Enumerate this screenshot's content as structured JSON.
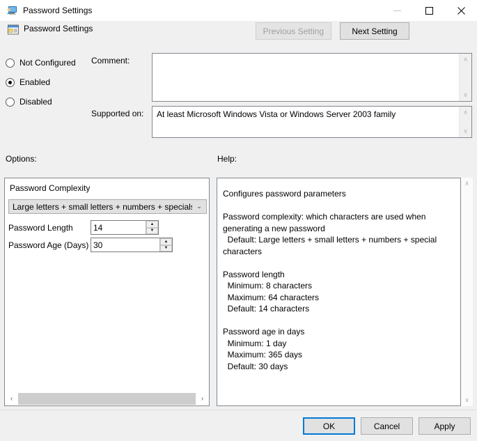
{
  "window": {
    "title": "Password Settings",
    "icon": "computer-user-icon",
    "minimize_label": "–",
    "maximize_label": "☐",
    "close_label": "✕"
  },
  "header": {
    "icon": "policy-setting-icon",
    "title": "Password Settings",
    "previous_setting": "Previous Setting",
    "next_setting": "Next Setting",
    "previous_disabled": true
  },
  "state": {
    "options": [
      {
        "label": "Not Configured",
        "selected": false
      },
      {
        "label": "Enabled",
        "selected": true
      },
      {
        "label": "Disabled",
        "selected": false
      }
    ]
  },
  "comment": {
    "label": "Comment:",
    "value": "",
    "placeholder": ""
  },
  "supported_on": {
    "label": "Supported on:",
    "value": "At least Microsoft Windows Vista or Windows Server 2003 family"
  },
  "options_section": {
    "label": "Options:",
    "group_title": "Password Complexity",
    "complexity": {
      "selected": "Large letters + small letters + numbers + specials",
      "arrow": "⌄"
    },
    "password_length": {
      "label": "Password Length",
      "value": "14"
    },
    "password_age": {
      "label": "Password Age (Days)",
      "value": "30"
    },
    "scroll_left": "‹",
    "scroll_right": "›"
  },
  "help_section": {
    "label": "Help:",
    "text": "Configures password parameters\n\nPassword complexity: which characters are used when generating a new password\n  Default: Large letters + small letters + numbers + special characters\n\nPassword length\n  Minimum: 8 characters\n  Maximum: 64 characters\n  Default: 14 characters\n\nPassword age in days\n  Minimum: 1 day\n  Maximum: 365 days\n  Default: 30 days",
    "scroll_up": "∧",
    "scroll_down": "∨"
  },
  "footer": {
    "ok": "OK",
    "cancel": "Cancel",
    "apply": "Apply"
  },
  "colors": {
    "accent": "#0078d7",
    "dialog_bg": "#f0f0f0",
    "field_border": "#828790"
  }
}
